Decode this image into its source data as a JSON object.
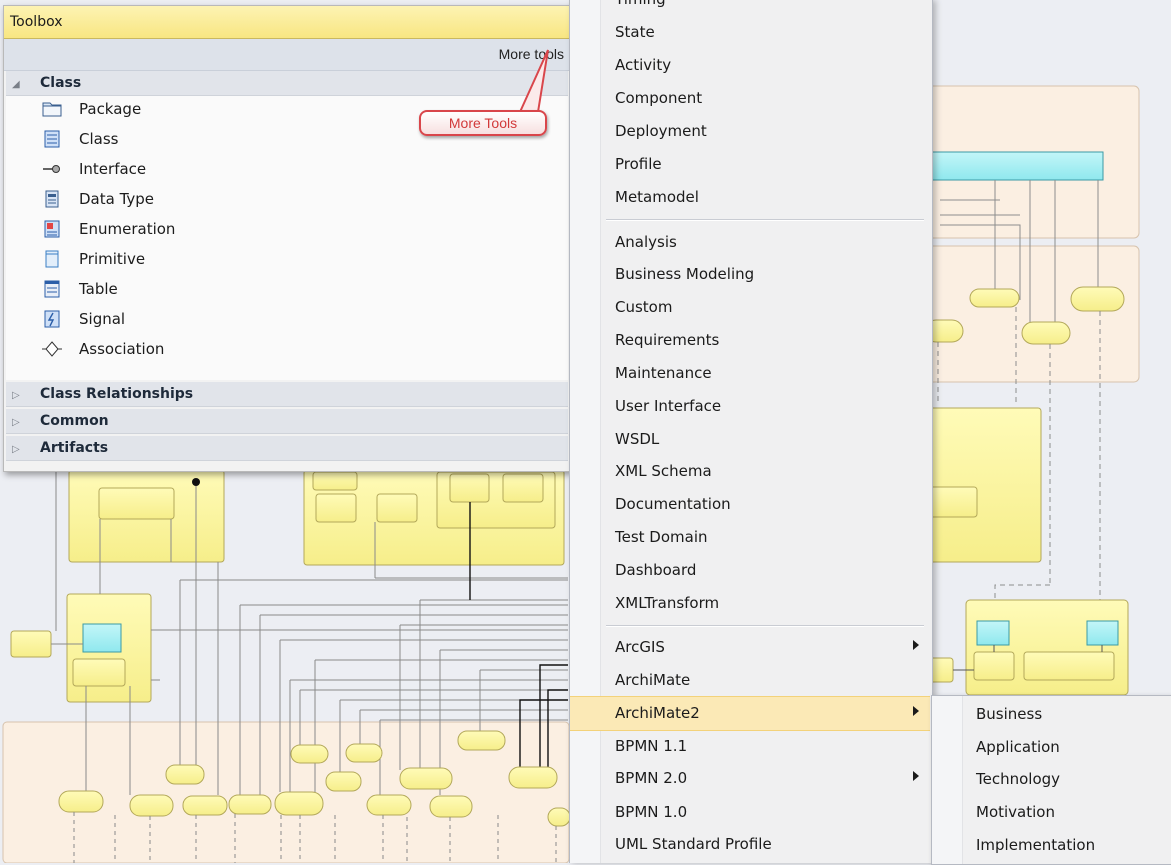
{
  "toolbox": {
    "title": "Toolbox",
    "more_tools_link": "More tools",
    "callout": "More Tools",
    "class_group": {
      "label": "Class",
      "expanded": true,
      "items": [
        {
          "label": "Package",
          "icon": "package-icon"
        },
        {
          "label": "Class",
          "icon": "class-icon"
        },
        {
          "label": "Interface",
          "icon": "interface-icon"
        },
        {
          "label": "Data Type",
          "icon": "data-type-icon"
        },
        {
          "label": "Enumeration",
          "icon": "enumeration-icon"
        },
        {
          "label": "Primitive",
          "icon": "primitive-icon"
        },
        {
          "label": "Table",
          "icon": "table-icon"
        },
        {
          "label": "Signal",
          "icon": "signal-icon"
        },
        {
          "label": "Association",
          "icon": "association-icon"
        }
      ]
    },
    "collapsed_groups": [
      "Class Relationships",
      "Common",
      "Artifacts"
    ]
  },
  "menu": {
    "items": [
      {
        "label": "Timing",
        "arrow": false
      },
      {
        "label": "State",
        "arrow": false
      },
      {
        "label": "Activity",
        "arrow": false
      },
      {
        "label": "Component",
        "arrow": false
      },
      {
        "label": "Deployment",
        "arrow": false
      },
      {
        "label": "Profile",
        "arrow": false
      },
      {
        "label": "Metamodel",
        "arrow": false
      },
      {
        "label": "Analysis",
        "arrow": false
      },
      {
        "label": "Business Modeling",
        "arrow": false
      },
      {
        "label": "Custom",
        "arrow": false
      },
      {
        "label": "Requirements",
        "arrow": false
      },
      {
        "label": "Maintenance",
        "arrow": false
      },
      {
        "label": "User Interface",
        "arrow": false
      },
      {
        "label": "WSDL",
        "arrow": false
      },
      {
        "label": "XML Schema",
        "arrow": false
      },
      {
        "label": "Documentation",
        "arrow": false
      },
      {
        "label": "Test Domain",
        "arrow": false
      },
      {
        "label": "Dashboard",
        "arrow": false
      },
      {
        "label": "XMLTransform",
        "arrow": false
      },
      {
        "label": "ArcGIS",
        "arrow": true
      },
      {
        "label": "ArchiMate",
        "arrow": false
      },
      {
        "label": "ArchiMate2",
        "arrow": true,
        "highlighted": true
      },
      {
        "label": "BPMN 1.1",
        "arrow": false
      },
      {
        "label": "BPMN 2.0",
        "arrow": true
      },
      {
        "label": "BPMN 1.0",
        "arrow": false
      },
      {
        "label": "UML Standard Profile",
        "arrow": false
      }
    ]
  },
  "submenu": {
    "items": [
      "Business",
      "Application",
      "Technology",
      "Motivation",
      "Implementation"
    ]
  },
  "colors": {
    "title_bar": "#f8e682",
    "menu_highlight": "#fbe9b6",
    "diagram_yellow": "#fff9a8",
    "diagram_cyan": "#a9f1f4",
    "diagram_beige": "#fbefe2",
    "callout_red": "#d9464b"
  }
}
